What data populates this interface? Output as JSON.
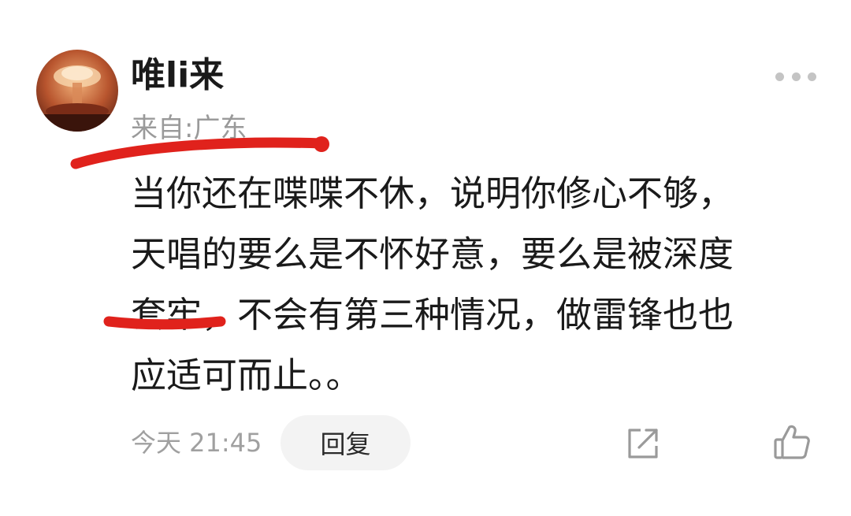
{
  "comment": {
    "username": "唯li来",
    "location": "来自:广东",
    "lines": [
      "当你还在喋喋不休，说明你修心不够，",
      "天唱的要么是不怀好意，要么是被深度",
      "套牢，不会有第三种情况，做雷锋也也",
      "应适可而止。。"
    ],
    "time": "今天 21:45",
    "reply_label": "回复"
  },
  "icons": {
    "avatar": "mushroom-cloud-avatar",
    "more": "more-dots-icon",
    "share": "share-icon",
    "like": "thumbs-up-icon"
  },
  "colors": {
    "username": "#1a1a1a",
    "secondary_text": "#9a9a9a",
    "reply_bg": "#f3f3f3",
    "annotation": "#e0221c"
  }
}
